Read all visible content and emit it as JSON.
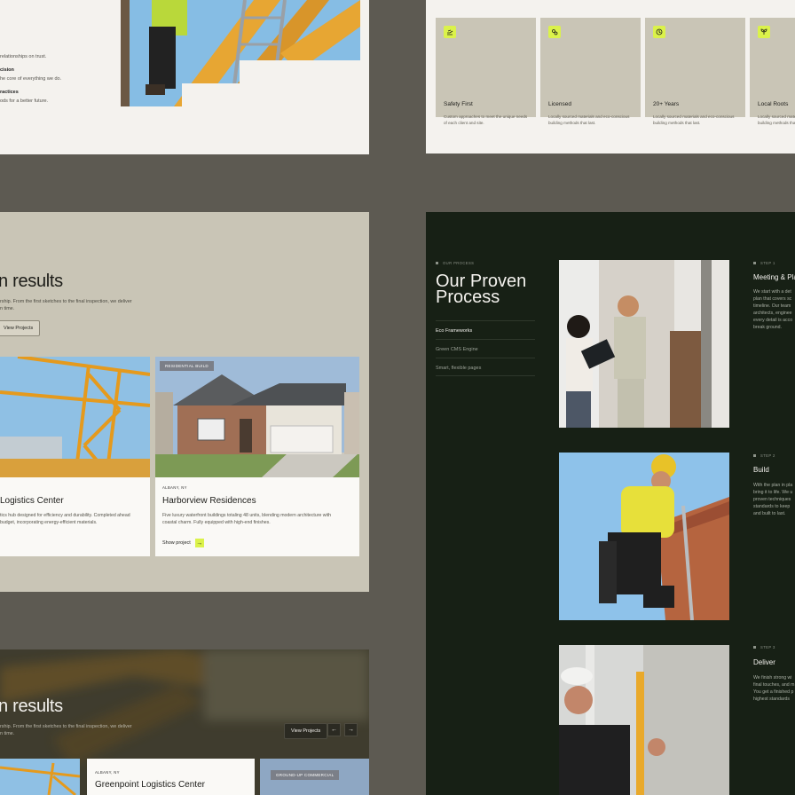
{
  "panel_a": {
    "lines": [
      "relationships on trust.",
      "cision",
      "he core of everything we do.",
      "ractices",
      "ods for a better future."
    ]
  },
  "panel_b": {
    "features": [
      {
        "title": "Safety First",
        "desc": "Custom approaches to meet the unique needs of each client and site.",
        "icon": "hand-icon"
      },
      {
        "title": "Licensed",
        "desc": "Locally sourced materials and eco-conscious building methods that last.",
        "icon": "people-icon"
      },
      {
        "title": "20+ Years",
        "desc": "Locally sourced materials and eco-conscious building methods that last.",
        "icon": "clock-icon"
      },
      {
        "title": "Local Roots",
        "desc": "Locally sourced materials and eco-conscious building methods that last.",
        "icon": "sprout-icon"
      }
    ]
  },
  "panel_c": {
    "heading": "n results",
    "subtext_1": "rship. From the first sketches to the final inspection, we deliver",
    "subtext_2": "n time.",
    "button": "View Projects",
    "cards": [
      {
        "title": "Logistics Center",
        "desc_1": "tics hub designed for efficiency and durability. Completed ahead",
        "desc_2": "budget, incorporating energy-efficient materials."
      },
      {
        "tag": "RESIDENTIAL BUILD",
        "location": "ALBANY, NY",
        "title": "Harborview Residences",
        "desc_1": "Five luxury waterfront buildings totaling 48 units, blending modern architecture with",
        "desc_2": "coastal charm. Fully equipped with high-end finishes.",
        "link": "Show project"
      }
    ]
  },
  "panel_d": {
    "eyebrow": "OUR PROCESS",
    "title": "Our Proven Process",
    "nav": [
      "Eco Frameworks",
      "Green CMS Engine",
      "Smart, flexible pages"
    ],
    "steps": [
      {
        "label": "STEP 1",
        "title": "Meeting & Pla",
        "lines": [
          "We start with a det",
          "plan that covers sc",
          "timeline. Our team",
          "architects, enginee",
          "every detail is acco",
          "break ground."
        ]
      },
      {
        "label": "STEP 2",
        "title": "Build",
        "lines": [
          "With the plan in pla",
          "bring it to life. We u",
          "proven techniques",
          "standards to keep",
          "and built to last."
        ]
      },
      {
        "label": "STEP 3",
        "title": "Deliver",
        "lines": [
          "We finish strong wi",
          "final touches, and m",
          "You get a finished p",
          "highest standards"
        ]
      }
    ]
  },
  "panel_e": {
    "heading": "n results",
    "subtext_1": "rship. From the first sketches to the final inspection, we deliver",
    "subtext_2": "n time.",
    "button": "View Projects",
    "card_location": "ALBANY, NY",
    "card_title": "Greenpoint Logistics Center",
    "tag": "GROUND-UP COMMERCIAL"
  },
  "colors": {
    "accent": "#dbf24a",
    "dark": "#172015",
    "sand": "#c9c5b6"
  }
}
